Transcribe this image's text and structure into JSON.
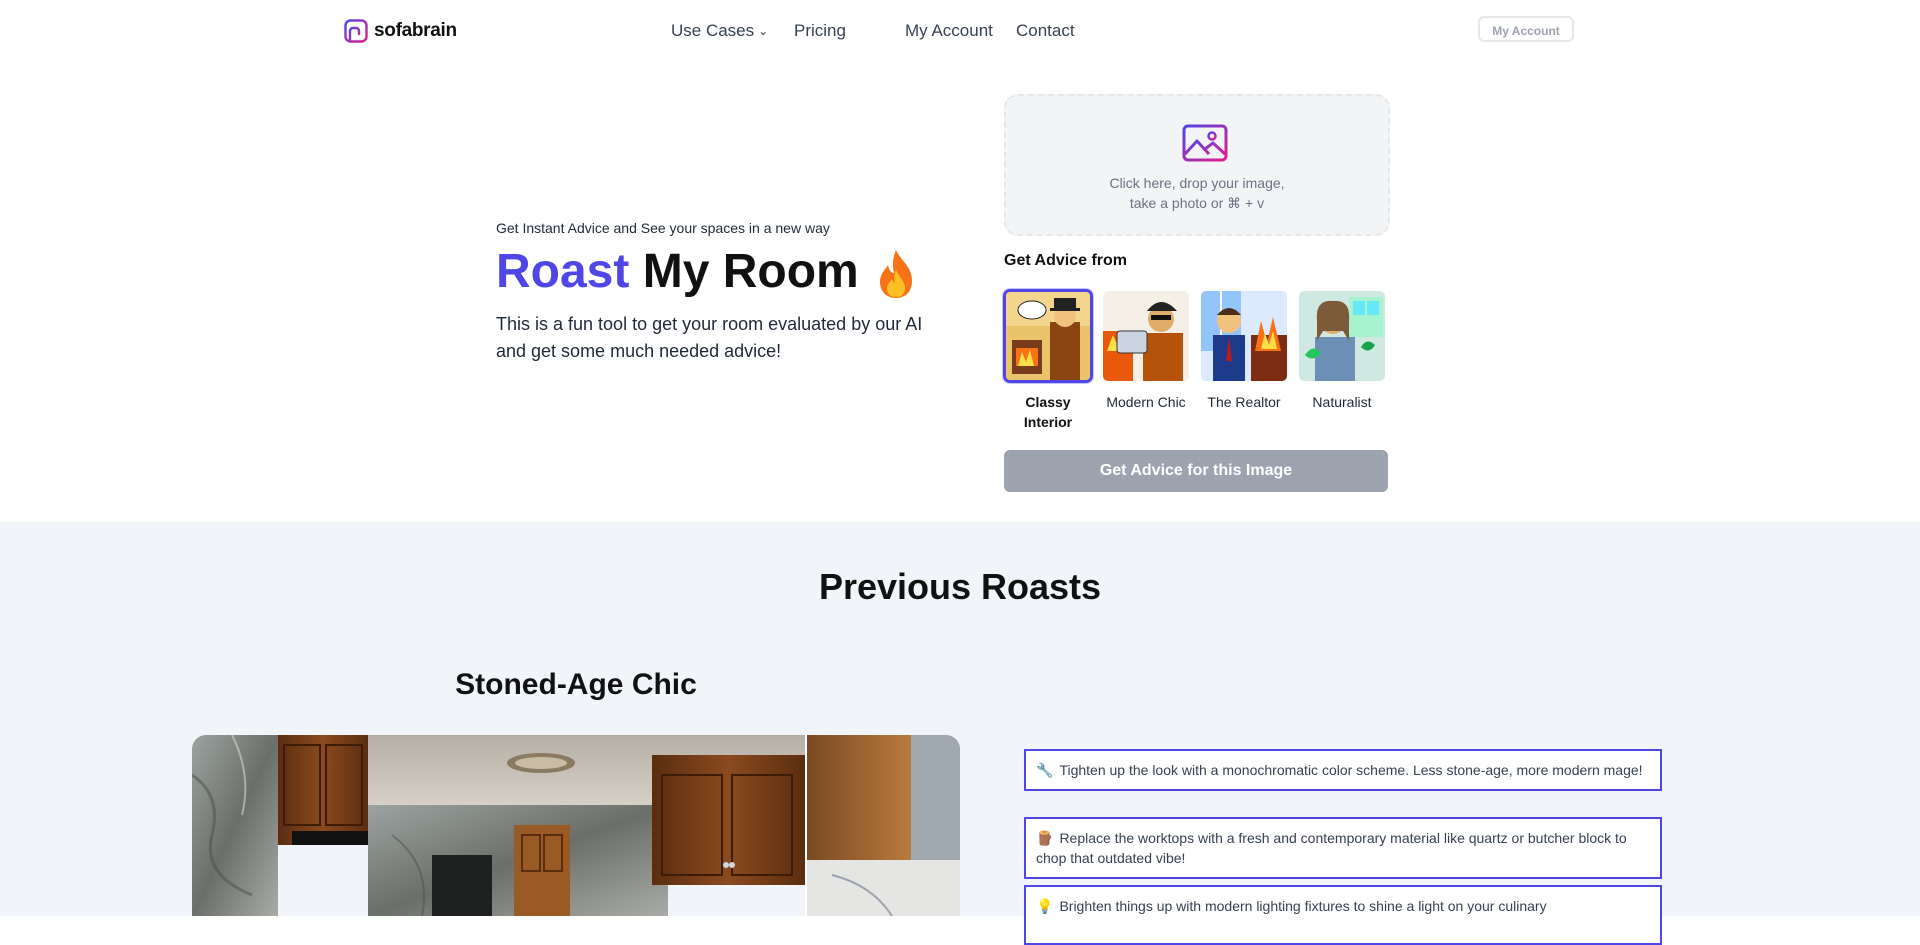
{
  "nav": {
    "brand": "sofabrain",
    "links": [
      "Use Cases",
      "Pricing",
      "My Account",
      "Contact"
    ],
    "account_button": "My Account"
  },
  "hero": {
    "subtitle": "Get Instant Advice and See your spaces in a new way",
    "title_accent": "Roast",
    "title_rest": "My Room",
    "description": "This is a fun tool to get your room evaluated by our AI and get some much needed advice!"
  },
  "upload": {
    "line1": "Click here, drop your image,",
    "line2": "take a photo or ⌘ + v"
  },
  "advice": {
    "label": "Get Advice from",
    "personas": [
      "Classy Interior",
      "Modern Chic",
      "The Realtor",
      "Naturalist"
    ],
    "selected": "Classy Interior",
    "button": "Get Advice for this Image"
  },
  "previous": {
    "title": "Previous Roasts",
    "roast": {
      "title": "Stoned-Age Chic",
      "tips": [
        {
          "icon": "🔧",
          "text": "Tighten up the look with a monochromatic color scheme. Less stone-age, more modern mage!"
        },
        {
          "icon": "🪵",
          "text": "Replace the worktops with a fresh and contemporary material like quartz or butcher block to chop that outdated vibe!"
        },
        {
          "icon": "💡",
          "text": "Brighten things up with modern lighting fixtures to shine a light on your culinary"
        }
      ]
    }
  },
  "colors": {
    "accent": "#5046e5",
    "flame_outer": "#f97316",
    "flame_inner": "#fbbf24",
    "button_disabled": "#9ca3af",
    "section_bg": "#f1f5f9"
  }
}
